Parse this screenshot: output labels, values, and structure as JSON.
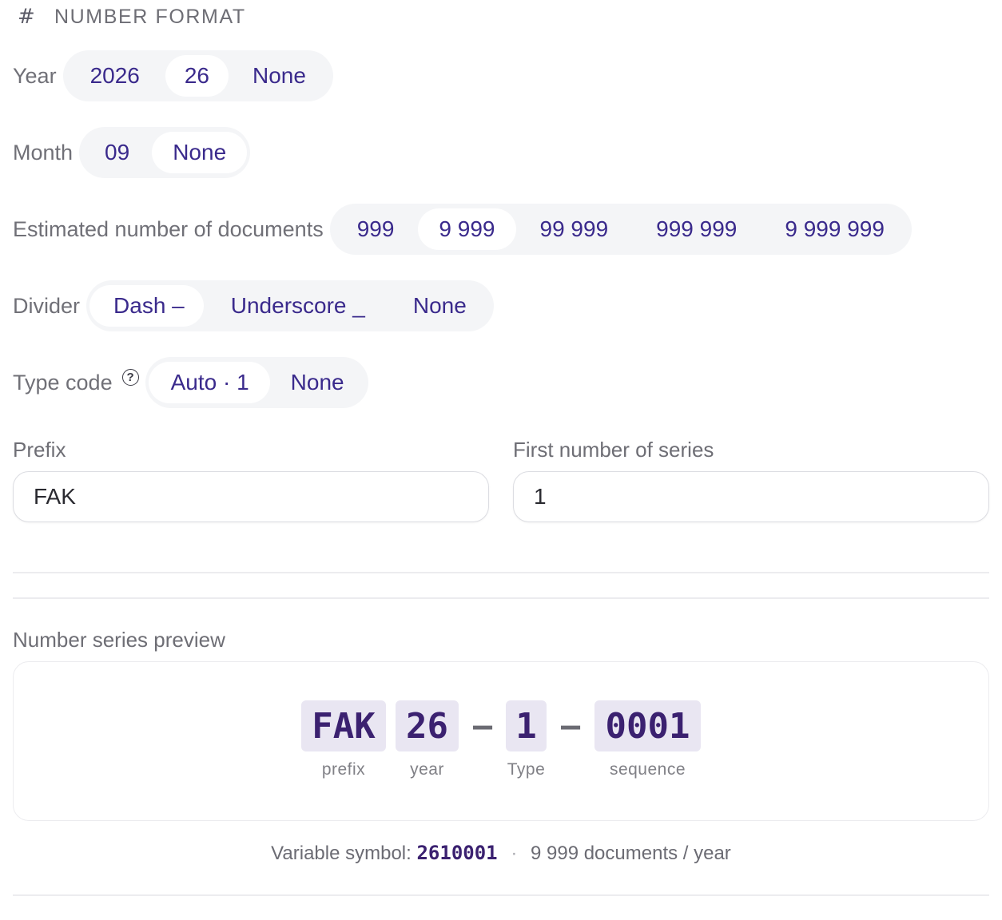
{
  "section": {
    "icon": "hash-icon",
    "title": "NUMBER FORMAT"
  },
  "year": {
    "label": "Year",
    "options": [
      "2026",
      "26",
      "None"
    ],
    "selected": "26"
  },
  "month": {
    "label": "Month",
    "options": [
      "09",
      "None"
    ],
    "selected": "None"
  },
  "estimated": {
    "label": "Estimated number of documents",
    "options": [
      "999",
      "9 999",
      "99 999",
      "999 999",
      "9 999 999"
    ],
    "selected": "9 999"
  },
  "divider_opt": {
    "label": "Divider",
    "options": [
      "Dash –",
      "Underscore _",
      "None"
    ],
    "selected": "Dash –"
  },
  "type_code": {
    "label": "Type code",
    "help_icon": "?",
    "options": [
      "Auto · 1",
      "None"
    ],
    "selected": "Auto · 1"
  },
  "prefix": {
    "label": "Prefix",
    "value": "FAK"
  },
  "first_number": {
    "label": "First number of series",
    "value": "1"
  },
  "preview": {
    "label": "Number series preview",
    "tokens": [
      {
        "text": "FAK",
        "caption": "prefix"
      },
      {
        "text": "26",
        "caption": "year"
      },
      {
        "text": "1",
        "caption": "Type"
      },
      {
        "text": "0001",
        "caption": "sequence"
      }
    ],
    "separator": "–"
  },
  "summary": {
    "variable_symbol_label": "Variable symbol:",
    "variable_symbol_value": "2610001",
    "dot": "·",
    "docs_per_year": "9 999 documents / year"
  },
  "colors": {
    "accent": "#3a2a8c",
    "token_bg": "#e9e6f2",
    "segment_bg": "#f4f5f7"
  }
}
